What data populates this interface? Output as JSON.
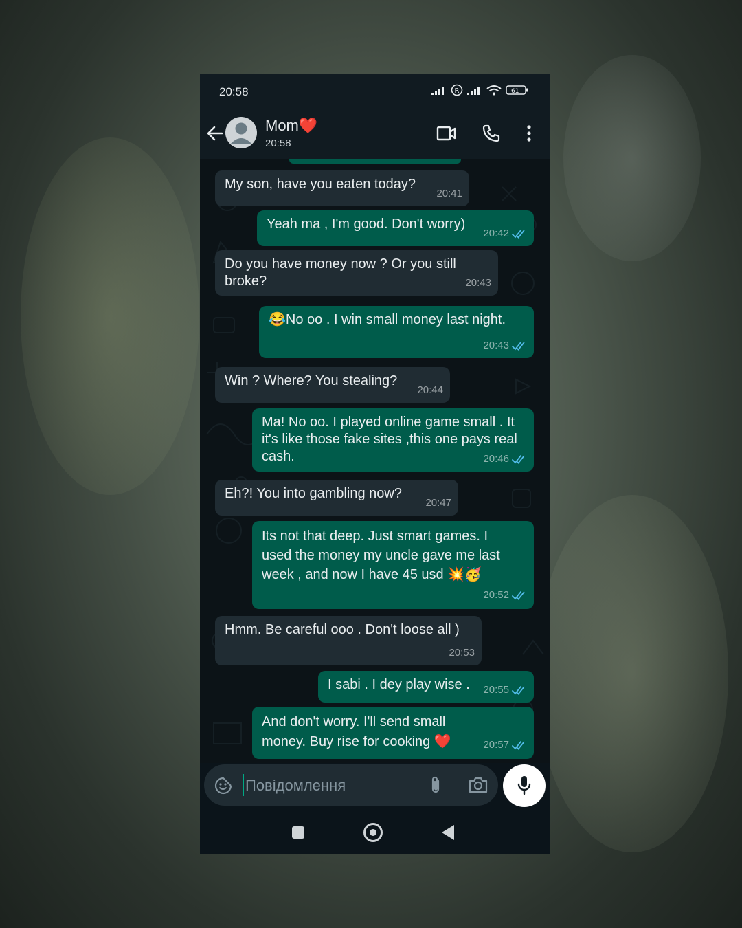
{
  "status": {
    "time": "20:58",
    "battery": "61"
  },
  "header": {
    "contact_name": "Mom",
    "contact_emoji": "❤️",
    "last_seen": "20:58",
    "icons": [
      "back-arrow-icon",
      "avatar",
      "video-call-icon",
      "phone-call-icon",
      "more-vert-icon"
    ]
  },
  "messages": [
    {
      "dir": "in",
      "text": "My son, have you eaten today?",
      "time": "20:41"
    },
    {
      "dir": "out",
      "text": "Yeah ma , I'm good. Don't worry)",
      "time": "20:42"
    },
    {
      "dir": "in",
      "text": "Do you have money now ? Or you still broke?",
      "time": "20:43"
    },
    {
      "dir": "out",
      "text": "😂No oo . I win small money last night.",
      "time": "20:43"
    },
    {
      "dir": "in",
      "text": "Win ? Where? You stealing?",
      "time": "20:44"
    },
    {
      "dir": "out",
      "text": "Ma! No oo. I played online game small . It it's like those fake sites ,this one pays real cash.",
      "time": "20:46"
    },
    {
      "dir": "in",
      "text": "Eh?! You into gambling now?",
      "time": "20:47"
    },
    {
      "dir": "out",
      "text": "Its not that deep. Just smart games. I used the money my uncle gave me last week , and now I have 45 usd 💥🥳",
      "time": "20:52"
    },
    {
      "dir": "in",
      "text": "Hmm. Be careful ooo . Don't loose all )",
      "time": "20:53"
    },
    {
      "dir": "out",
      "text": "I sabi . I dey play wise .",
      "time": "20:55"
    },
    {
      "dir": "out",
      "text": "And don't worry. I'll send small money. Buy rise for cooking ❤️",
      "time": "20:57"
    }
  ],
  "composer": {
    "placeholder": "Повідомлення"
  },
  "colors": {
    "incoming_bubble": "#202c33",
    "outgoing_bubble": "#005c4b",
    "read_ticks": "#53bdeb",
    "background": "#0b141a"
  }
}
